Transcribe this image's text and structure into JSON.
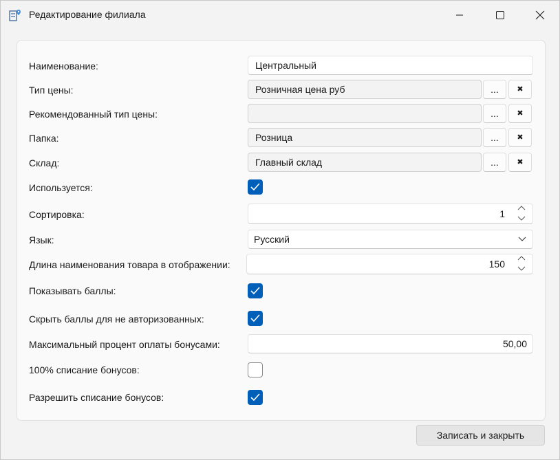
{
  "window": {
    "title": "Редактирование филиала"
  },
  "fields": {
    "name": {
      "label": "Наименование:",
      "value": "Центральный"
    },
    "price_type": {
      "label": "Тип цены:",
      "value": "Розничная цена руб"
    },
    "recommended_price_type": {
      "label": "Рекомендованный тип цены:",
      "value": ""
    },
    "folder": {
      "label": "Папка:",
      "value": "Розница"
    },
    "warehouse": {
      "label": "Склад:",
      "value": "Главный склад"
    },
    "in_use": {
      "label": "Используется:",
      "checked": true
    },
    "sort": {
      "label": "Сортировка:",
      "value": "1"
    },
    "language": {
      "label": "Язык:",
      "value": "Русский"
    },
    "name_length": {
      "label": "Длина наименования товара в отображении:",
      "value": "150"
    },
    "show_points": {
      "label": "Показывать баллы:",
      "checked": true
    },
    "hide_points_unauth": {
      "label": "Скрыть баллы для не авторизованных:",
      "checked": true
    },
    "max_bonus_percent": {
      "label": "Максимальный процент оплаты бонусами:",
      "value": "50,00"
    },
    "full_bonus_writeoff": {
      "label": "100% списание бонусов:",
      "checked": false
    },
    "allow_bonus_writeoff": {
      "label": "Разрешить списание бонусов:",
      "checked": true
    }
  },
  "buttons": {
    "select": "...",
    "clear": "✖",
    "save_close": "Записать и закрыть"
  },
  "colors": {
    "accent": "#005fb8",
    "window_bg": "#f3f3f3",
    "panel_bg": "#fafafa"
  },
  "icons": {
    "app": "building-map-icon",
    "minimize": "minimize-icon",
    "maximize": "maximize-icon",
    "close": "close-icon",
    "spin_up": "chevron-up-icon",
    "spin_down": "chevron-down-icon",
    "checkmark": "check-icon"
  }
}
